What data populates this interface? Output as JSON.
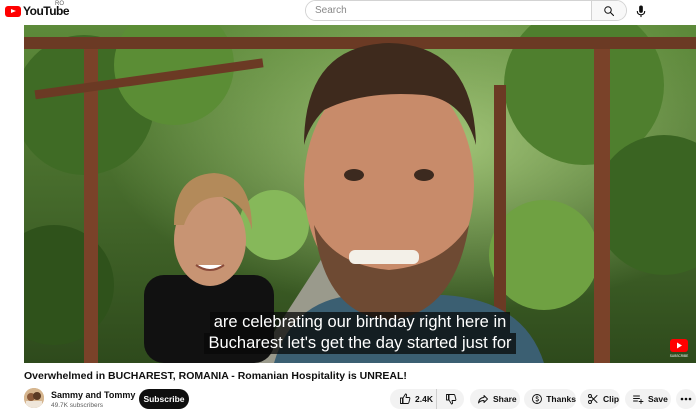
{
  "header": {
    "logo_text": "YouTube",
    "country_code": "RO",
    "search_placeholder": "Search"
  },
  "video": {
    "caption_lines": [
      "are celebrating our birthday right here in",
      "Bucharest let's get the day started just for"
    ],
    "watermark_text": "SUBSCRIBE"
  },
  "meta": {
    "title": "Overwhelmed in BUCHAREST, ROMANIA - Romanian Hospitality is UNREAL!",
    "channel_name": "Sammy and Tommy",
    "subscriber_count": "49.7K subscribers",
    "subscribe_label": "Subscribe"
  },
  "actions": {
    "like_count": "2.4K",
    "share_label": "Share",
    "thanks_label": "Thanks",
    "clip_label": "Clip",
    "save_label": "Save"
  },
  "colors": {
    "brand_red": "#ff0000",
    "subscribe_bg": "#0f0f0f",
    "pill_bg": "#f2f2f2"
  }
}
